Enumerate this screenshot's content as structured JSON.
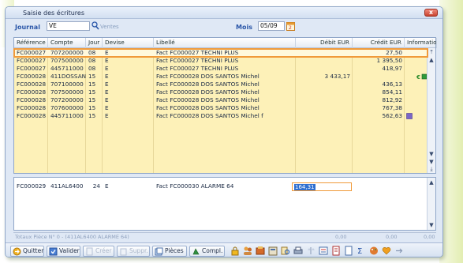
{
  "window": {
    "title": "Saisie des écritures",
    "close_label": "x"
  },
  "filters": {
    "journal_label": "Journal",
    "journal_value": "VE",
    "journal_name": "Ventes",
    "mois_label": "Mois",
    "mois_value": "05/09"
  },
  "columns": [
    "Référence",
    "Compte",
    "Jour",
    "Devise",
    "Libellé",
    "Débit EUR",
    "Crédit EUR",
    "Information"
  ],
  "rows": [
    {
      "ref": "FC000027",
      "compte": "707200000",
      "jour": "08",
      "devise": "E",
      "libelle": "Fact FC000027 TECHNI PLUS",
      "debit": "",
      "credit": "27,50",
      "info": ""
    },
    {
      "ref": "FC000027",
      "compte": "707500000",
      "jour": "08",
      "devise": "E",
      "libelle": "Fact FC000027 TECHNI PLUS",
      "debit": "",
      "credit": "1 395,50",
      "info": ""
    },
    {
      "ref": "FC000027",
      "compte": "445711000",
      "jour": "08",
      "devise": "E",
      "libelle": "Fact FC000027 TECHNI PLUS",
      "debit": "",
      "credit": "418,97",
      "info": ""
    },
    {
      "ref": "FC000028",
      "compte": "411DOSSAN",
      "jour": "15",
      "devise": "E",
      "libelle": "Fact FC000028 DOS SANTOS Michel",
      "debit": "3 433,17",
      "credit": "",
      "info": "icons"
    },
    {
      "ref": "FC000028",
      "compte": "707100000",
      "jour": "15",
      "devise": "E",
      "libelle": "Fact FC000028 DOS SANTOS Michel",
      "debit": "",
      "credit": "436,13",
      "info": ""
    },
    {
      "ref": "FC000028",
      "compte": "707500000",
      "jour": "15",
      "devise": "E",
      "libelle": "Fact FC000028 DOS SANTOS Michel",
      "debit": "",
      "credit": "854,11",
      "info": ""
    },
    {
      "ref": "FC000028",
      "compte": "707200000",
      "jour": "15",
      "devise": "E",
      "libelle": "Fact FC000028 DOS SANTOS Michel",
      "debit": "",
      "credit": "812,92",
      "info": ""
    },
    {
      "ref": "FC000028",
      "compte": "707600000",
      "jour": "15",
      "devise": "E",
      "libelle": "Fact FC000028 DOS SANTOS Michel",
      "debit": "",
      "credit": "767,38",
      "info": ""
    },
    {
      "ref": "FC000028",
      "compte": "445711000",
      "jour": "15",
      "devise": "E",
      "libelle": "Fact FC000028 DOS SANTOS Michel f",
      "debit": "",
      "credit": "562,63",
      "info": "icon"
    }
  ],
  "entry": {
    "ref": "FC000029",
    "compte": "411AL6400",
    "jour": "24",
    "devise": "E",
    "libelle": "Fact FC000030 ALARME 64",
    "debit_value": "164,31"
  },
  "totals": {
    "label": "Totaux Pièce N° 0 - (411AL6400 ALARME 64)",
    "debit": "0,00",
    "credit": "0,00",
    "solde": "0,00"
  },
  "toolbar": {
    "quitter": "Quitter",
    "valider": "Valider",
    "creer": "Créer",
    "suppr": "Suppr.",
    "pieces": "Pièces",
    "compl": "Compl."
  },
  "colors": {
    "accent": "#f09a3a",
    "row_bg": "#fdf1b8",
    "label_blue": "#2a56a8"
  }
}
